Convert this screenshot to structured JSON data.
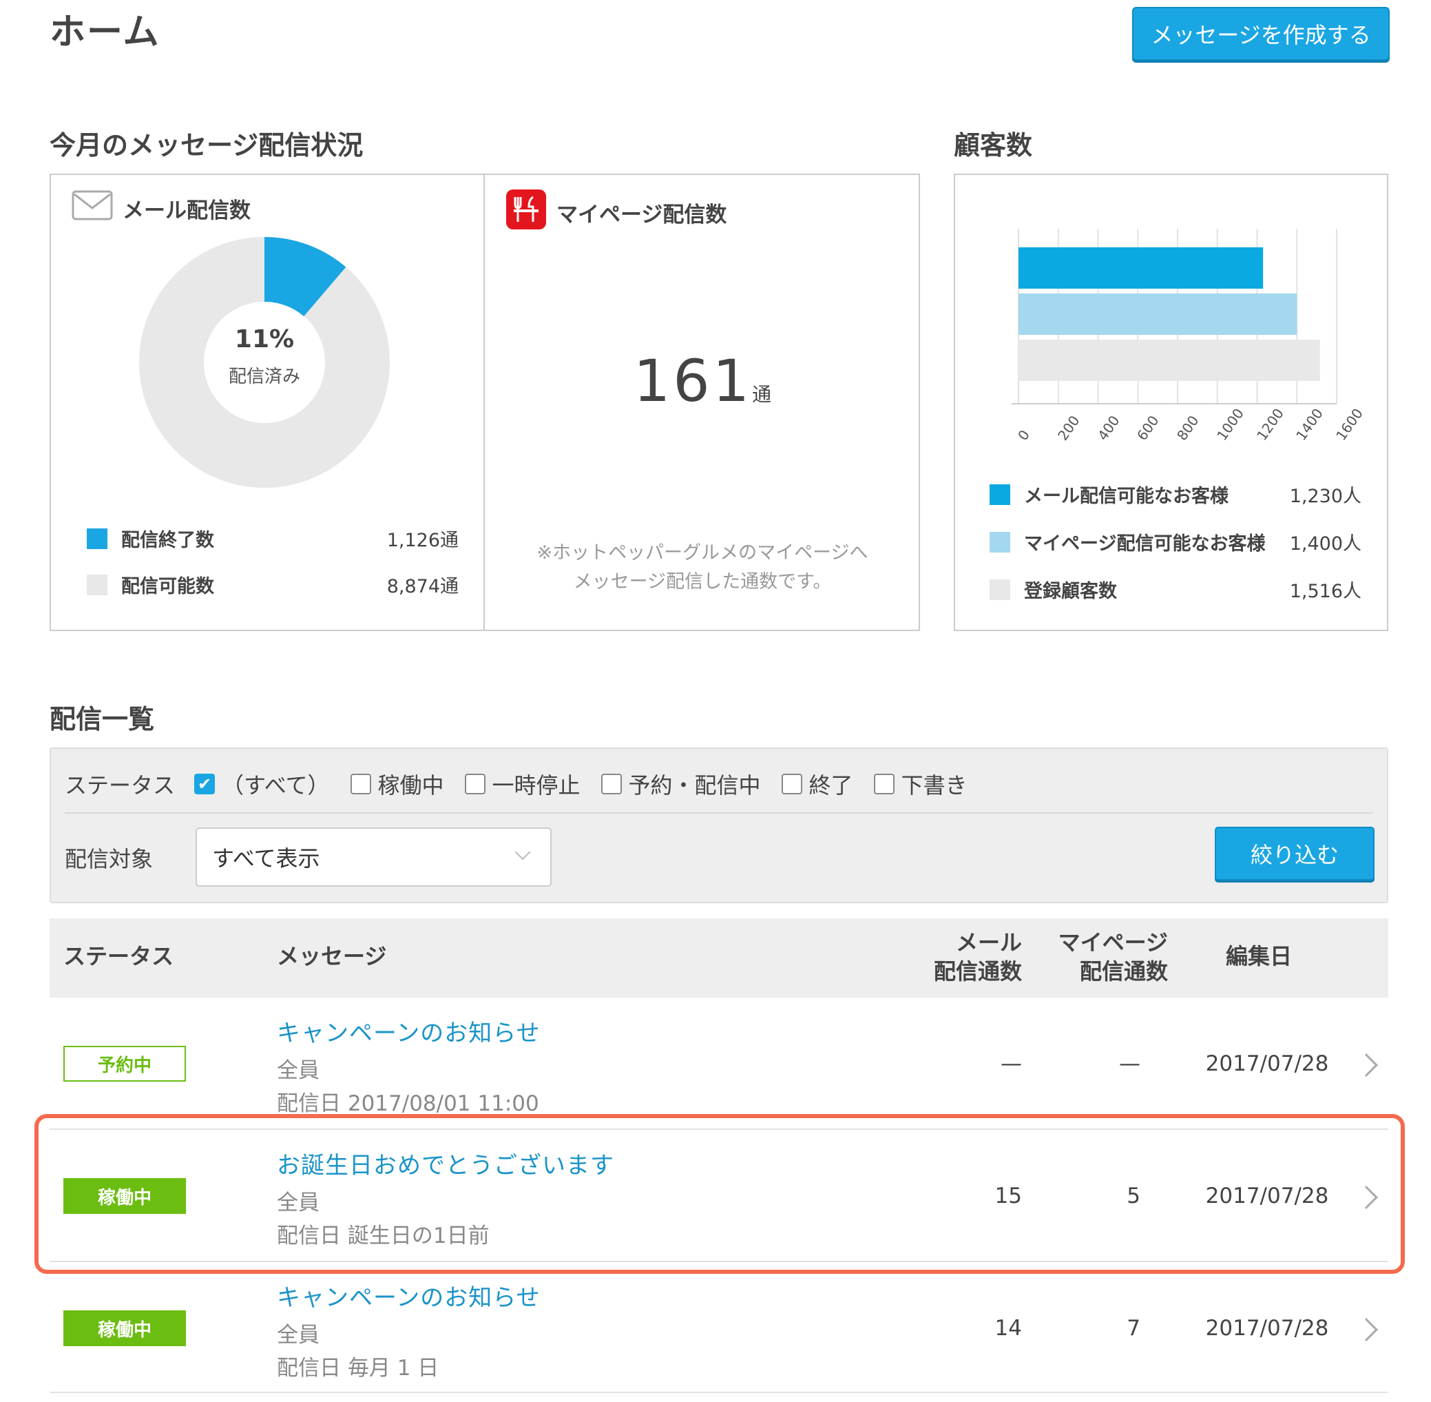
{
  "header": {
    "title": "ホーム",
    "compose_label": "メッセージを作成する"
  },
  "status_section": {
    "title": "今月のメッセージ配信状況",
    "mail": {
      "title": "メール配信数",
      "donut_percent": "11%",
      "donut_caption": "配信済み",
      "donut_fraction": 0.1126,
      "legend": [
        {
          "label": "配信終了数",
          "value": "1,126通",
          "color": "#1aa6e3"
        },
        {
          "label": "配信可能数",
          "value": "8,874通",
          "color": "#e8e8e8"
        }
      ]
    },
    "mypage": {
      "title": "マイページ配信数",
      "count": "161",
      "unit": "通",
      "note_line1": "※ホットペッパーグルメのマイページへ",
      "note_line2": "メッセージ配信した通数です。"
    }
  },
  "customers": {
    "title": "顧客数",
    "legend": [
      {
        "label": "メール配信可能なお客様",
        "value": "1,230人",
        "color": "#0aa9e2"
      },
      {
        "label": "マイページ配信可能なお客様",
        "value": "1,400人",
        "color": "#a3d8ee"
      },
      {
        "label": "登録顧客数",
        "value": "1,516人",
        "color": "#e8e8e8"
      }
    ]
  },
  "chart_data": {
    "type": "bar",
    "orientation": "horizontal",
    "categories": [
      "メール配信可能なお客様",
      "マイページ配信可能なお客様",
      "登録顧客数"
    ],
    "values": [
      1230,
      1400,
      1516
    ],
    "colors": [
      "#0aa9e2",
      "#a3d8ee",
      "#e8e8e8"
    ],
    "xlim": [
      0,
      1600
    ],
    "ticks": [
      "0",
      "200",
      "400",
      "600",
      "800",
      "1000",
      "1200",
      "1400",
      "1600"
    ],
    "grid": true
  },
  "list": {
    "title": "配信一覧",
    "filter": {
      "status_label": "ステータス",
      "options": [
        {
          "label": "（すべて）",
          "checked": true
        },
        {
          "label": "稼働中",
          "checked": false
        },
        {
          "label": "一時停止",
          "checked": false
        },
        {
          "label": "予約・配信中",
          "checked": false
        },
        {
          "label": "終了",
          "checked": false
        },
        {
          "label": "下書き",
          "checked": false
        }
      ],
      "target_label": "配信対象",
      "target_value": "すべて表示",
      "submit_label": "絞り込む"
    },
    "columns": {
      "status": "ステータス",
      "message": "メッセージ",
      "mail_line1": "メール",
      "mail_line2": "配信通数",
      "mypage_line1": "マイページ",
      "mypage_line2": "配信通数",
      "edited": "編集日"
    },
    "rows": [
      {
        "status": "予約中",
        "title": "キャンペーンのお知らせ",
        "target": "全員",
        "schedule": "配信日 2017/08/01 11:00",
        "mail": "—",
        "mypage": "—",
        "edited": "2017/07/28"
      },
      {
        "status": "稼働中",
        "title": "お誕生日おめでとうございます",
        "target": "全員",
        "schedule": "配信日 誕生日の1日前",
        "mail": "15",
        "mypage": "5",
        "edited": "2017/07/28"
      },
      {
        "status": "稼働中",
        "title": "キャンペーンのお知らせ",
        "target": "全員",
        "schedule": "配信日 毎月 1 日",
        "mail": "14",
        "mypage": "7",
        "edited": "2017/07/28"
      }
    ]
  }
}
